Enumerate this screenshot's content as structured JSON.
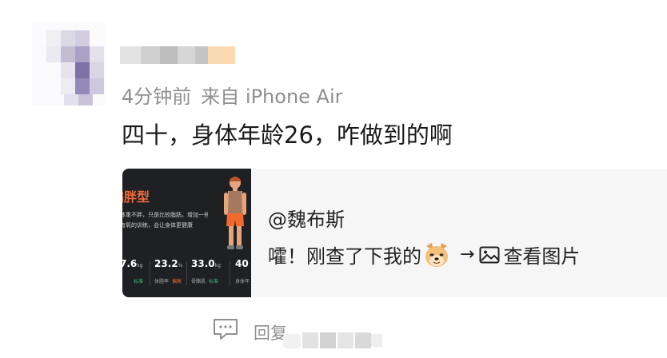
{
  "comment": {
    "meta": {
      "time": "4分钟前",
      "source": "来自 iPhone Air"
    },
    "text": "四十，身体年龄26，咋做到的啊",
    "quote": {
      "at_user": "@魏布斯",
      "text_before_emoji": "嚯！刚查了下我的",
      "emoji_icon": "doge-icon",
      "arrow": "→",
      "image_icon": "image-icon",
      "link_label": "查看图片",
      "thumbnail": {
        "type_title": "偏胖型",
        "desc_lines": [
          "体重不胖，只是比较脂肪。增加一些",
          "有氧的训练，会让身体更健康"
        ],
        "stats": [
          {
            "value": "7.6",
            "unit": "kg",
            "label": "",
            "tag": "标准",
            "tag_color": "#3cc07a"
          },
          {
            "value": "23.2",
            "unit": "%",
            "label": "体脂率",
            "tag": "偏高",
            "tag_color": "#ef6a3b"
          },
          {
            "value": "33.0",
            "unit": "kg",
            "label": "骨骼肌",
            "tag": "标准",
            "tag_color": "#3cc07a"
          },
          {
            "value": "40",
            "unit": "",
            "label": "身体年",
            "tag": "",
            "tag_color": ""
          }
        ]
      }
    },
    "actions": {
      "reply_label": "回复",
      "reply_icon": "comment-icon"
    }
  },
  "colors": {
    "meta_text": "#8f8f8f",
    "body_text": "#1a1a1a",
    "quote_bg": "#f6f6f6",
    "accent_orange": "#ef6a3b"
  }
}
